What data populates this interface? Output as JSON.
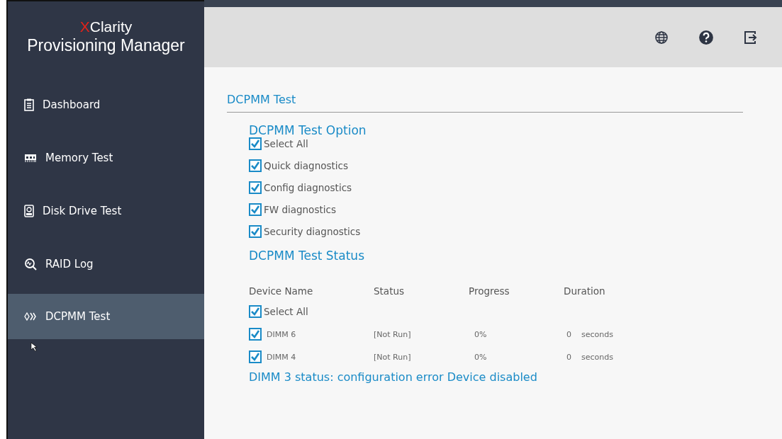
{
  "logo": {
    "mark": "X",
    "name": "Clarity",
    "subtitle": "Provisioning Manager"
  },
  "sidebar": {
    "items": [
      {
        "label": "Dashboard",
        "kind": "clipboard",
        "selected": false
      },
      {
        "label": "Memory Test",
        "kind": "memory",
        "selected": false
      },
      {
        "label": "Disk Drive Test",
        "kind": "disk",
        "selected": false
      },
      {
        "label": "RAID Log",
        "kind": "raid",
        "selected": false
      },
      {
        "label": "DCPMM Test",
        "kind": "dcpmm",
        "selected": true
      }
    ]
  },
  "toolbar": {
    "buttons": [
      {
        "kind": "globe"
      },
      {
        "kind": "help"
      },
      {
        "kind": "exit"
      }
    ]
  },
  "page": {
    "title": "DCPMM Test",
    "options": {
      "heading": "DCPMM Test Option",
      "items": [
        {
          "label": "Select All",
          "checked": true
        },
        {
          "label": "Quick diagnostics",
          "checked": true
        },
        {
          "label": "Config diagnostics",
          "checked": true
        },
        {
          "label": "FW diagnostics",
          "checked": true
        },
        {
          "label": "Security diagnostics",
          "checked": true
        }
      ]
    },
    "status": {
      "heading": "DCPMM Test Status",
      "columns": [
        "Device Name",
        "Status",
        "Progress",
        "Duration"
      ],
      "select_all": {
        "label": "Select All",
        "checked": true
      },
      "rows": [
        {
          "device": "DIMM 6",
          "checked": true,
          "status": "[Not Run]",
          "progress": "0%",
          "duration": "0",
          "unit": "seconds"
        },
        {
          "device": "DIMM 4",
          "checked": true,
          "status": "[Not Run]",
          "progress": "0%",
          "duration": "0",
          "unit": "seconds"
        }
      ]
    },
    "message": "DIMM 3 status: configuration error Device disabled"
  }
}
